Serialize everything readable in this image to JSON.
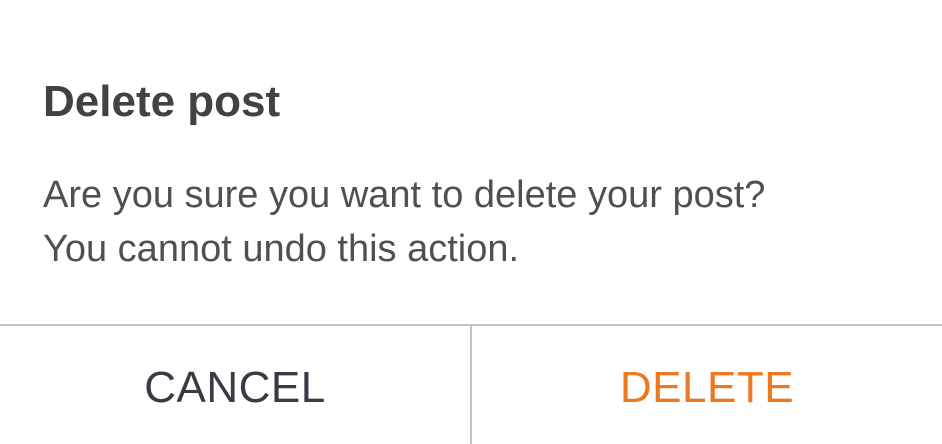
{
  "dialog": {
    "title": "Delete post",
    "message_line1": "Are you sure you want to delete your post?",
    "message_line2": "You cannot undo this action.",
    "cancel_label": "CANCEL",
    "delete_label": "DELETE"
  },
  "colors": {
    "cancel_text": "#3f3646",
    "delete_text": "#f07722",
    "divider": "#c4c4c4"
  }
}
